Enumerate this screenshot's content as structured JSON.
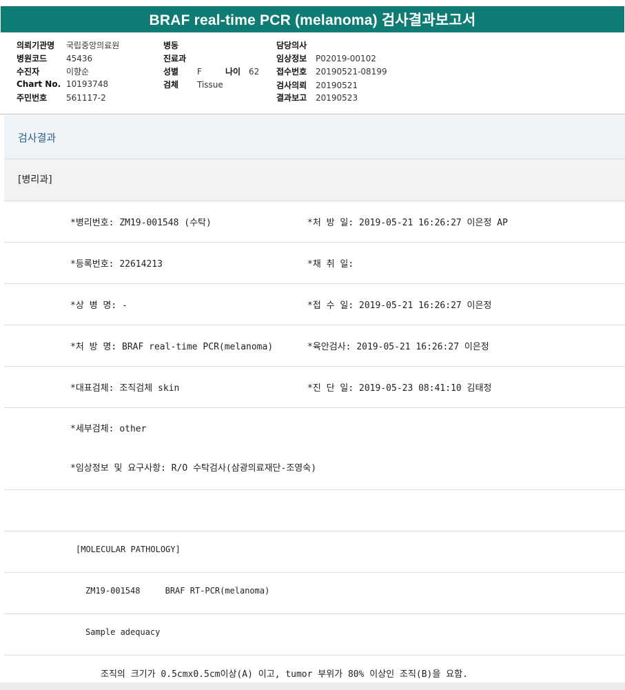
{
  "title": "BRAF real-time PCR (melanoma) 검사결과보고서",
  "patient_info": {
    "col1": [
      {
        "label": "의뢰기관명",
        "value": "국립중앙의료원"
      },
      {
        "label": "병원코드",
        "value": "45436"
      },
      {
        "label": "수진자",
        "value": "이향순"
      },
      {
        "label": "Chart No.",
        "value": "10193748"
      },
      {
        "label": "주민번호",
        "value": "561117-2"
      }
    ],
    "col2": [
      {
        "label": "병동",
        "value": ""
      },
      {
        "label": "진료과",
        "value": ""
      },
      {
        "label": "성별",
        "value": "F"
      },
      {
        "label": "검체",
        "value": "Tissue"
      }
    ],
    "age": {
      "label": "나이",
      "value": "62"
    },
    "col3": [
      {
        "label": "담당의사",
        "value": ""
      },
      {
        "label": "임상정보",
        "value": "P02019-00102"
      },
      {
        "label": "접수번호",
        "value": "20190521-08199"
      },
      {
        "label": "검사의뢰",
        "value": "20190521"
      },
      {
        "label": "결과보고",
        "value": "20190523"
      }
    ]
  },
  "section_title": "검사결과",
  "department": "[병리과]",
  "fields": {
    "r1_left": "*병리번호: ZM19-001548 (수탁)",
    "r1_right": "*처 방 일: 2019-05-21 16:26:27  이은정 AP",
    "r2_left": "*등록번호: 22614213",
    "r2_right": "*채 취 일:",
    "r3_left": "*상 병 명: -",
    "r3_right": "*접 수 일: 2019-05-21 16:26:27  이은정",
    "r4_left": "*처 방 명: BRAF real-time PCR(melanoma)",
    "r4_right": "*육안검사: 2019-05-21 16:26:27  이은정",
    "r5_left": "*대표검체: 조직검체 skin",
    "r5_right": "*진 단 일: 2019-05-23 08:41:10  김태정",
    "r6_left": "*세부검체: other",
    "r7_left": "*임상정보 및 요구사항: R/O 수탁검사(삼광의료재단-조영숙)"
  },
  "molecular": {
    "header": "[MOLECULAR PATHOLOGY]",
    "id_line": "ZM19-001548     BRAF RT-PCR(melanoma)",
    "adequacy": "Sample adequacy",
    "note": "조직의 크기가 0.5cmx0.5cm이상(A) 이고, tumor 부위가 80% 이상인 조직(B)을 요함."
  }
}
